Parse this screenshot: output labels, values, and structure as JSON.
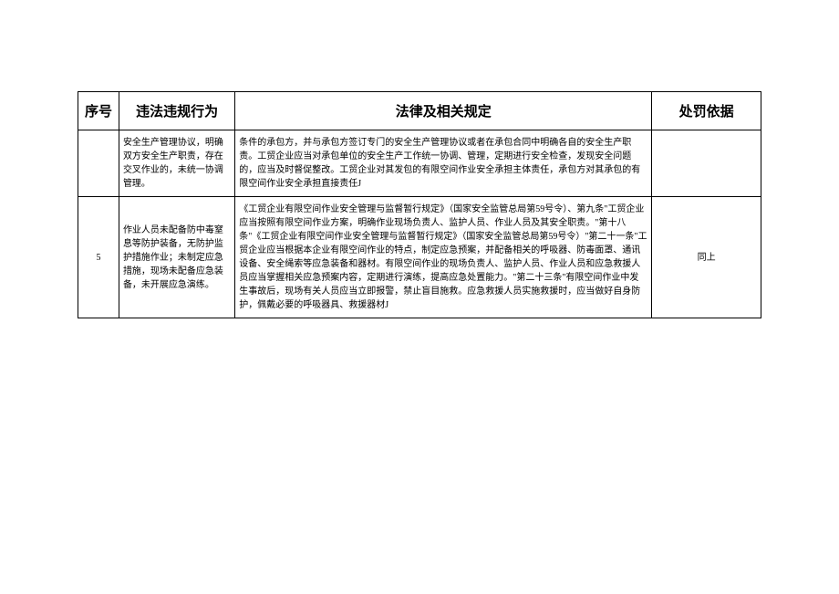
{
  "headers": {
    "seq": "序号",
    "violation": "违法违规行为",
    "law": "法律及相关规定",
    "basis": "处罚依据"
  },
  "rows": [
    {
      "seq": "",
      "violation": "安全生产管理协议，明确双方安全生产职责，存在交叉作业的，未统一协调管理。",
      "law": "条件的承包方，并与承包方签订专门的安全生产管理协议或者在承包合同中明确各自的安全生产职责。工贸企业应当对承包单位的安全生产工作统一协调、管理，定期进行安全检查，发现安全问题的，应当及时督促整改。工贸企业对其发包的有限空间作业安全承担主体责任，承包方对其承包的有限空间作业安全承担直接责任J",
      "basis": ""
    },
    {
      "seq": "5",
      "violation": "作业人员未配备防中毒窒息等防护装备，无防护监护措施作业；未制定应急措施，现场未配备应急装备，未开展应急演练。",
      "law": "《工贸企业有限空间作业安全管理与监督暂行规定》（国家安全监管总局第59号令）、第九条\"工贸企业应当按照有限空间作业方案，明确作业现场负责人、监护人员、作业人员及其安全职责。\"第十八条\"《工贸企业有限空间作业安全管理与监督暂行规定》（国家安全监管总局第59号令）\"第二十一条\"工贸企业应当根据本企业有限空间作业的特点，制定应急预案，并配备相关的呼吸器、防毒面罩、通讯设备、安全绳索等应急装备和器材。有限空间作业的现场负责人、监护人员、作业人员和应急救援人员应当掌握相关应急预案内容，定期进行演练，提高应急处置能力。\"第二十三条\"有限空间作业中发生事故后，现场有关人员应当立即报警，禁止盲目施救。应急救援人员实施救援时，应当做好自身防护，佩戴必要的呼吸器具、救援器材J",
      "basis": "同上"
    }
  ]
}
